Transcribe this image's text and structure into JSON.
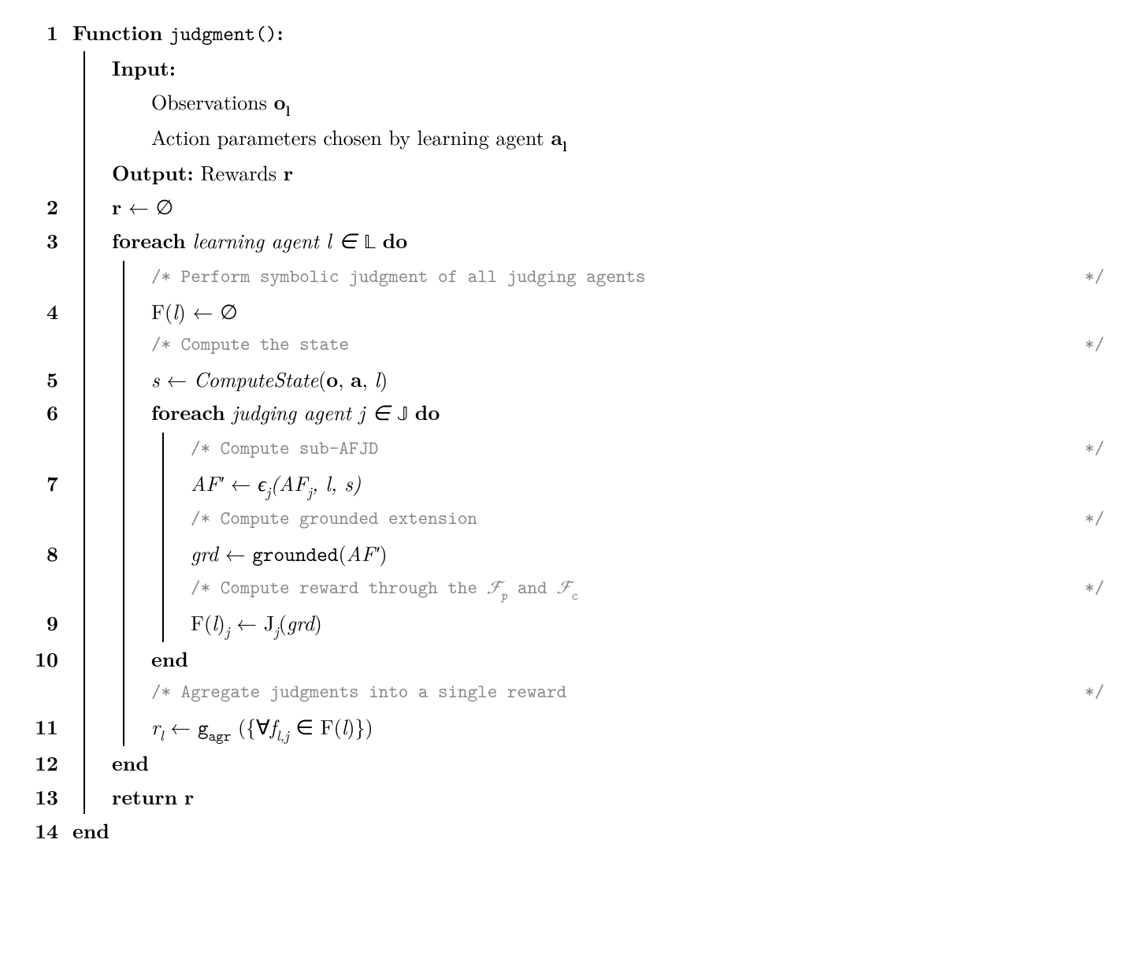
{
  "lines": {
    "l1": "1",
    "l2": "2",
    "l3": "3",
    "l4": "4",
    "l5": "5",
    "l6": "6",
    "l7": "7",
    "l8": "8",
    "l9": "9",
    "l10": "10",
    "l11": "11",
    "l12": "12",
    "l13": "13",
    "l14": "14"
  },
  "kw": {
    "function": "Function",
    "input": "Input:",
    "output": "Output:",
    "foreach": "foreach",
    "do": "do",
    "end": "end",
    "return": "return"
  },
  "text": {
    "fname": "judgment()",
    "colon": ":",
    "input_obs": "Observations ",
    "o_l": "o",
    "sub_l_bold": "l",
    "input_act": "Action parameters chosen by learning agent ",
    "a_l": "a",
    "output_r": " Rewards ",
    "r": "r",
    "r_empty_lhs": "r",
    "arrow": " ← ",
    "empty": "∅",
    "learning_agent": "learning agent l ∈ ",
    "LL": "𝕃",
    "judging_agent": "judging agent j ∈ ",
    "JJ": "𝕁",
    "Fl": "F(",
    "l": "l",
    "close": ")",
    "s": "s",
    "computestate": "ComputeState",
    "cs_args": "(o, a, ",
    "AF_prime": "AF′",
    "eps": "ϵ",
    "sub_j": "j",
    "af_args_open": "(AF",
    "af_args_rest": ", l, s)",
    "grd": "grd",
    "grounded_fn": "grounded",
    "grounded_args": "(AF′)",
    "J": "J",
    "J_args": "(grd)",
    "r_l": "r",
    "sub_l": "l",
    "g_agr": "g",
    "agr": "agr",
    "agg_open": " ({∀",
    "f": "f",
    "sub_lj": "l,j",
    "in_Fl": " ∈ F(",
    "agg_close": ")})",
    "Fl_sub_j_arrow_J": ")"
  },
  "comments": {
    "c1": "/* Perform symbolic judgment of all judging agents",
    "c2": "/* Compute the state",
    "c3": "/* Compute sub-AFJD",
    "c4": "/* Compute grounded extension",
    "c5_a": "/* Compute reward through the ",
    "c5_fp": "ℱ",
    "c5_p": "p",
    "c5_and": " and ",
    "c5_fc": "ℱ",
    "c5_c": "c",
    "c6": "/* Agregate judgments into a single reward",
    "close": "*/"
  }
}
